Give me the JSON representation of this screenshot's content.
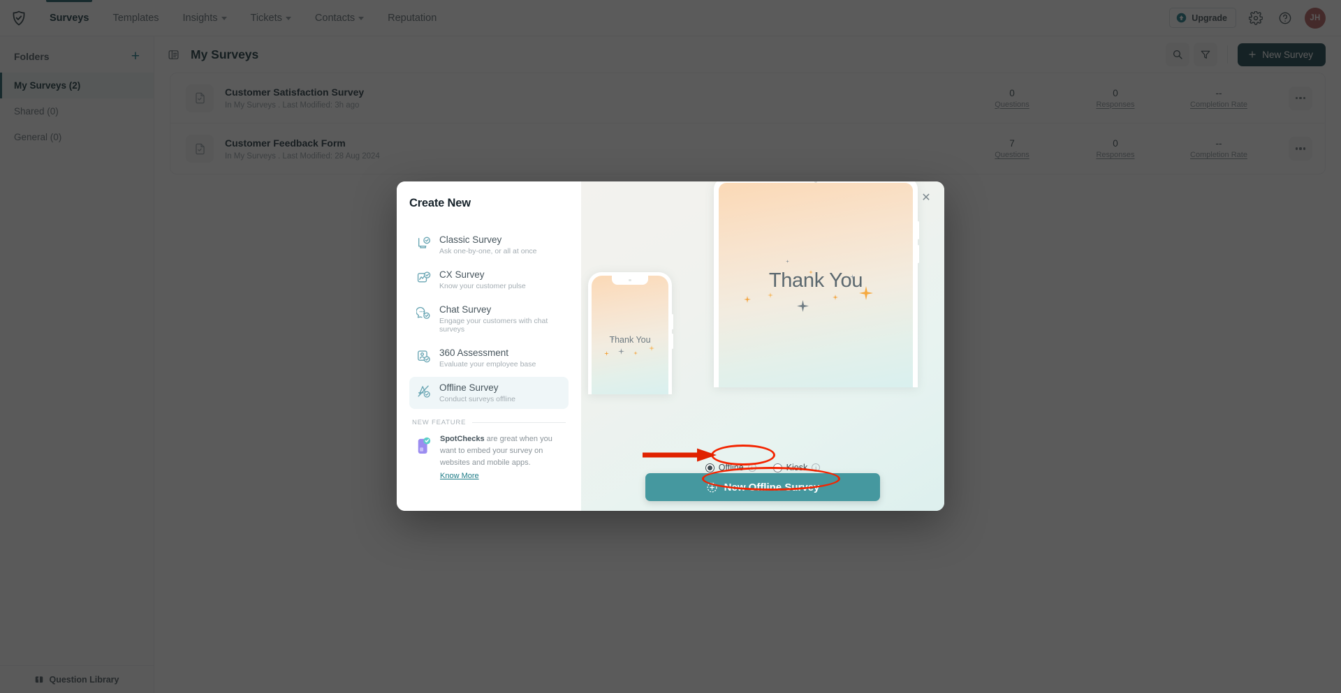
{
  "brand": {
    "logo_icon": "shield-check-logo",
    "accent_teal": "#1d5b66",
    "cta_teal": "#45989f",
    "annotation_red": "#f32400"
  },
  "topnav": {
    "items": [
      {
        "label": "Surveys",
        "active": true,
        "has_caret": false
      },
      {
        "label": "Templates",
        "active": false,
        "has_caret": false
      },
      {
        "label": "Insights",
        "active": false,
        "has_caret": true
      },
      {
        "label": "Tickets",
        "active": false,
        "has_caret": true
      },
      {
        "label": "Contacts",
        "active": false,
        "has_caret": true
      },
      {
        "label": "Reputation",
        "active": false,
        "has_caret": false
      }
    ],
    "upgrade_label": "Upgrade",
    "upgrade_icon": "upgrade-arrow-icon",
    "settings_icon": "gear-icon",
    "help_icon": "help-circle-icon",
    "avatar_initials": "JH"
  },
  "sidebar": {
    "title": "Folders",
    "add_icon": "plus-icon",
    "items": [
      {
        "label": "My Surveys (2)",
        "active": true
      },
      {
        "label": "Shared (0)",
        "active": false
      },
      {
        "label": "General (0)",
        "active": false
      }
    ],
    "question_library_label": "Question Library",
    "question_library_icon": "question-library-icon"
  },
  "main": {
    "menu_icon": "hamburger-icon",
    "page_title": "My Surveys",
    "search_icon": "search-icon",
    "filter_icon": "filter-icon",
    "new_survey_label": "New Survey",
    "new_survey_icon": "plus-icon",
    "stat_labels": {
      "questions": "Questions",
      "responses": "Responses",
      "completion": "Completion Rate"
    },
    "rows": [
      {
        "name": "Customer Satisfaction Survey",
        "meta": "In My Surveys . Last Modified: 3h ago",
        "questions": "0",
        "responses": "0",
        "completion": "--"
      },
      {
        "name": "Customer Feedback Form",
        "meta": "In My Surveys . Last Modified: 28 Aug 2024",
        "questions": "7",
        "responses": "0",
        "completion": "--"
      }
    ]
  },
  "modal": {
    "title": "Create New",
    "close_icon": "close-icon",
    "types": [
      {
        "name": "Classic Survey",
        "desc": "Ask one-by-one, or all at once",
        "icon": "classic-survey-icon",
        "selected": false
      },
      {
        "name": "CX Survey",
        "desc": "Know your customer pulse",
        "icon": "cx-survey-icon",
        "selected": false
      },
      {
        "name": "Chat Survey",
        "desc": "Engage your customers with chat surveys",
        "icon": "chat-survey-icon",
        "selected": false
      },
      {
        "name": "360 Assessment",
        "desc": "Evaluate your employee base",
        "icon": "assessment-360-icon",
        "selected": false
      },
      {
        "name": "Offline Survey",
        "desc": "Conduct surveys offline",
        "icon": "offline-survey-icon",
        "selected": true
      }
    ],
    "new_feature_label": "NEW FEATURE",
    "spotcheck": {
      "icon": "spotchecks-phone-icon",
      "bold": "SpotChecks",
      "text": " are great when you want to embed your survey on websites and mobile apps.",
      "link": "Know More"
    },
    "preview": {
      "tablet_text": "Thank You",
      "phone_text": "Thank You"
    },
    "options": [
      {
        "label": "Offline",
        "selected": true,
        "info_icon": "info-icon"
      },
      {
        "label": "Kiosk",
        "selected": false,
        "info_icon": "info-icon"
      }
    ],
    "cta_label": "New Offline Survey",
    "cta_icon": "add-circle-icon"
  }
}
